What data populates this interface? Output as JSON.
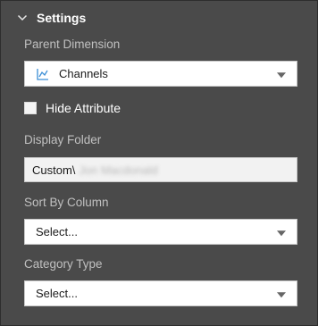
{
  "section": {
    "title": "Settings",
    "chevron_icon": "chevron-down-icon"
  },
  "parent_dimension": {
    "label": "Parent Dimension",
    "value": "Channels",
    "icon": "hierarchy-axis-icon"
  },
  "hide_attribute": {
    "label": "Hide Attribute",
    "checked": false
  },
  "display_folder": {
    "label": "Display Folder",
    "value_prefix": "Custom\\",
    "value_redacted": "Jon Macdonald"
  },
  "sort_by_column": {
    "label": "Sort By Column",
    "value": "Select..."
  },
  "category_type": {
    "label": "Category Type",
    "value": "Select..."
  },
  "colors": {
    "panel_bg": "#4a4a4a",
    "label_text": "#c0c0c0",
    "title_text": "#ffffff",
    "input_bg": "#ffffff",
    "dim_icon_accent": "#3c8fd6"
  }
}
